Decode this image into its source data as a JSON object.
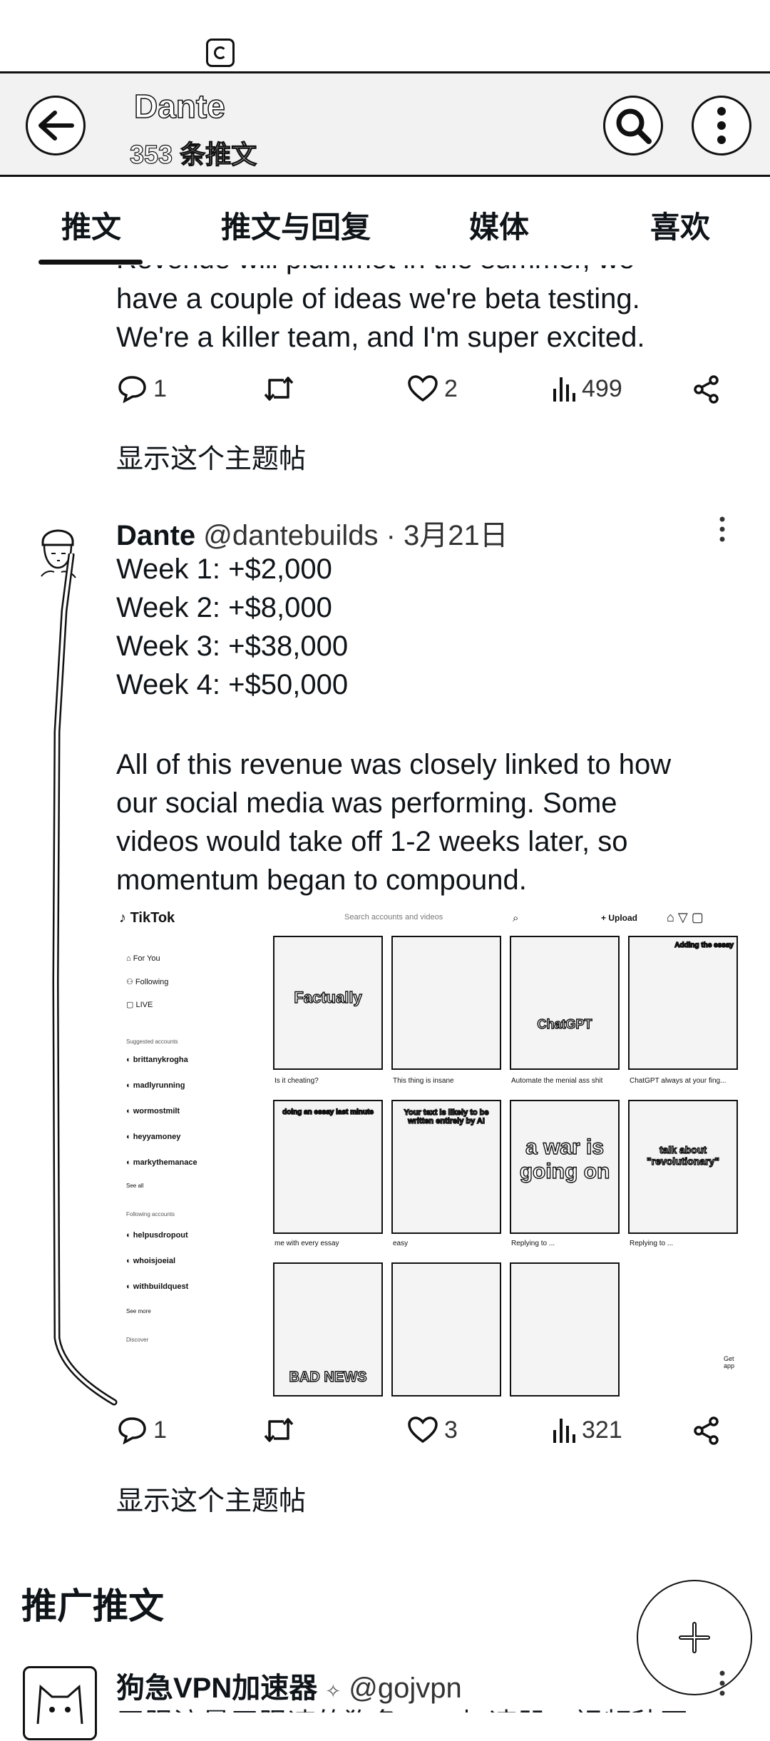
{
  "header": {
    "name": "Dante",
    "count": "353 条推文"
  },
  "tabs": [
    "推文",
    "推文与回复",
    "媒体",
    "喜欢"
  ],
  "tweet1": {
    "clipped_line": "Revenue will plummet in the summer, we",
    "lines": [
      "have a couple of ideas we're beta testing.",
      "We're a killer team, and I'm super excited."
    ],
    "replies": "1",
    "likes": "2",
    "views": "499",
    "show_thread": "显示这个主题帖"
  },
  "tweet2": {
    "author": "Dante",
    "handle": "@dantebuilds",
    "date": "· 3月21日",
    "lines": [
      "Week 1: +$2,000",
      "Week 2: +$8,000",
      "Week 3: +$38,000",
      "Week 4: +$50,000",
      "",
      "All of this revenue was closely linked to how",
      "our social media was performing. Some",
      "videos would take off 1-2 weeks later, so",
      "momentum began to compound."
    ],
    "replies": "1",
    "likes": "3",
    "views": "321",
    "show_thread": "显示这个主题帖",
    "media": {
      "app": "TikTok",
      "search_placeholder": "Search accounts and videos",
      "upload": "+ Upload",
      "nav": [
        "For You",
        "Following",
        "LIVE"
      ],
      "suggested_label": "Suggested accounts",
      "suggested": [
        "brittanykrogha",
        "madlyrunning",
        "wormostmilt",
        "heyyamoney",
        "markythemanace"
      ],
      "see_all": "See all",
      "following_label": "Following accounts",
      "following": [
        "helpusdropout",
        "whoisjoeial",
        "withbuildquest"
      ],
      "see_more": "See more",
      "discover": "Discover",
      "thumbs": [
        {
          "text": "Factually",
          "caption": "Is it cheating?"
        },
        {
          "text": "",
          "caption": "This thing is insane"
        },
        {
          "text": "ChatGPT",
          "caption": "Automate the menial ass shit"
        },
        {
          "text": "Adding the essay",
          "caption": "ChatGPT always at your fing..."
        },
        {
          "text": "doing an essay last minute",
          "caption": "me with every essay"
        },
        {
          "text": "Your text is likely to be written entirely by AI",
          "caption": "easy"
        },
        {
          "text": "a war is going on",
          "caption": "Replying to ..."
        },
        {
          "text": "talk about \"revolutionary\"",
          "caption": "Replying to ..."
        },
        {
          "text": "BAD NEWS",
          "caption": ""
        },
        {
          "text": "",
          "caption": ""
        },
        {
          "text": "",
          "caption": ""
        }
      ],
      "get_app": "Get app"
    }
  },
  "promoted": {
    "title": "推广推文",
    "author": "狗急VPN加速器",
    "handle": "@gojvpn",
    "text": "无限流量无限速的狗急VPN加速器，视频秒开"
  }
}
